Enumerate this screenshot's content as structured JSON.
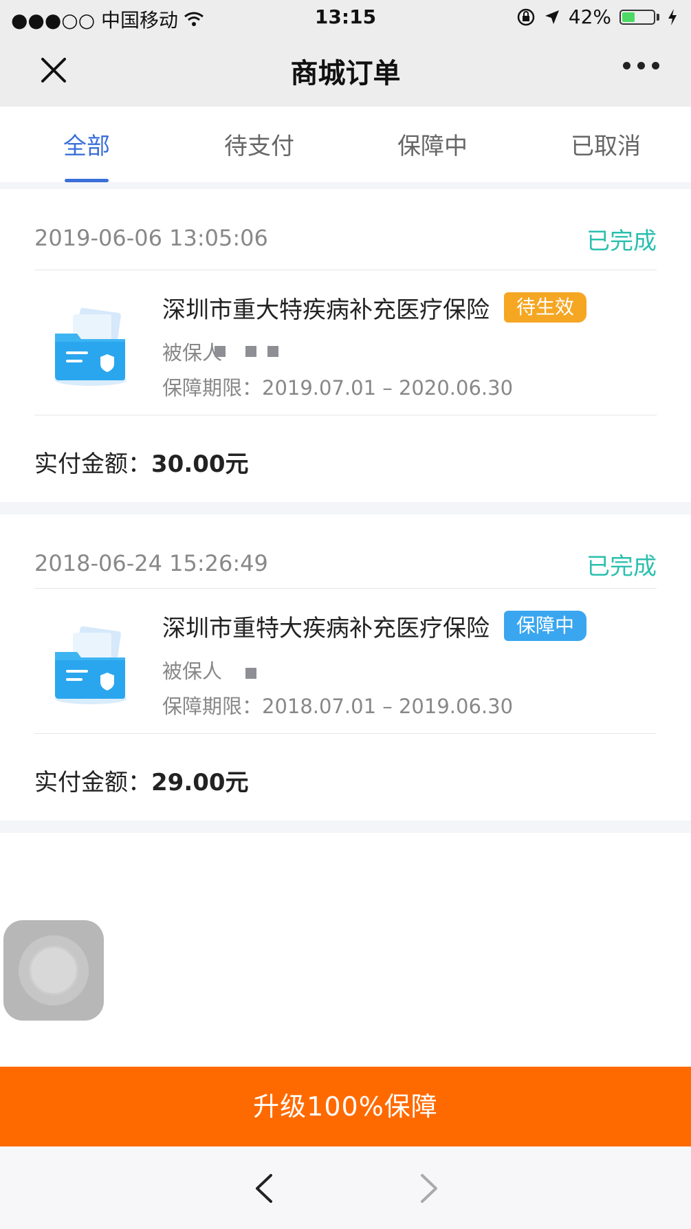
{
  "status_bar": {
    "carrier": "●●●○○ 中国移动",
    "time": "13:15",
    "battery": "42%",
    "battery_level": 0.42
  },
  "header": {
    "title": "商城订单"
  },
  "tabs": [
    {
      "label": "全部",
      "active": true
    },
    {
      "label": "待支付",
      "active": false
    },
    {
      "label": "保障中",
      "active": false
    },
    {
      "label": "已取消",
      "active": false
    }
  ],
  "orders": [
    {
      "time": "2019-06-06 13:05:06",
      "status": "已完成",
      "product_name": "深圳市重大特疾病补充医疗保险",
      "badge": "待生效",
      "badge_color": "#f5a623",
      "insured_label": "被保人",
      "period": "保障期限：2019.07.01 – 2020.06.30",
      "paid_label": "实付金额：",
      "paid_amount": "30.00元"
    },
    {
      "time": "2018-06-24 15:26:49",
      "status": "已完成",
      "product_name": "深圳市重特大疾病补充医疗保险",
      "badge": "保障中",
      "badge_color": "#3aa6f0",
      "insured_label": "被保人",
      "period": "保障期限：2018.07.01 – 2019.06.30",
      "paid_label": "实付金额：",
      "paid_amount": "29.00元"
    }
  ],
  "upgrade_button": "升级100%保障",
  "colors": {
    "accent_tab": "#3a6fd8",
    "status_complete": "#2bbfae",
    "upgrade": "#ff6a00"
  },
  "icons": [
    "close-icon",
    "more-icon",
    "wifi-icon",
    "lock-rotation-icon",
    "location-arrow-icon",
    "battery-icon",
    "charging-icon",
    "insurance-folder-icon",
    "back-arrow-icon",
    "forward-arrow-icon"
  ]
}
